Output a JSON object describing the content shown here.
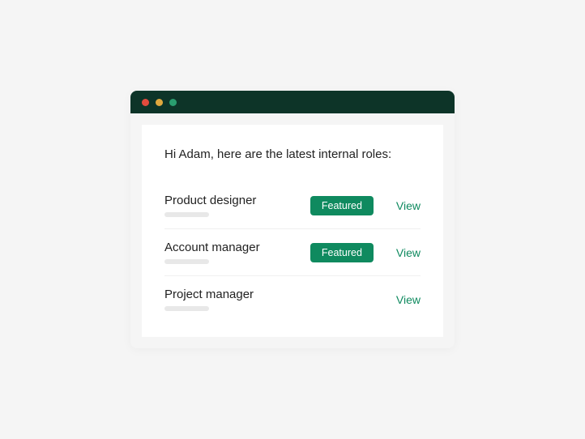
{
  "greeting": "Hi Adam, here are the latest internal roles:",
  "featured_label": "Featured",
  "view_label": "View",
  "roles": [
    {
      "title": "Product designer",
      "featured": true
    },
    {
      "title": "Account manager",
      "featured": true
    },
    {
      "title": "Project manager",
      "featured": false
    }
  ]
}
